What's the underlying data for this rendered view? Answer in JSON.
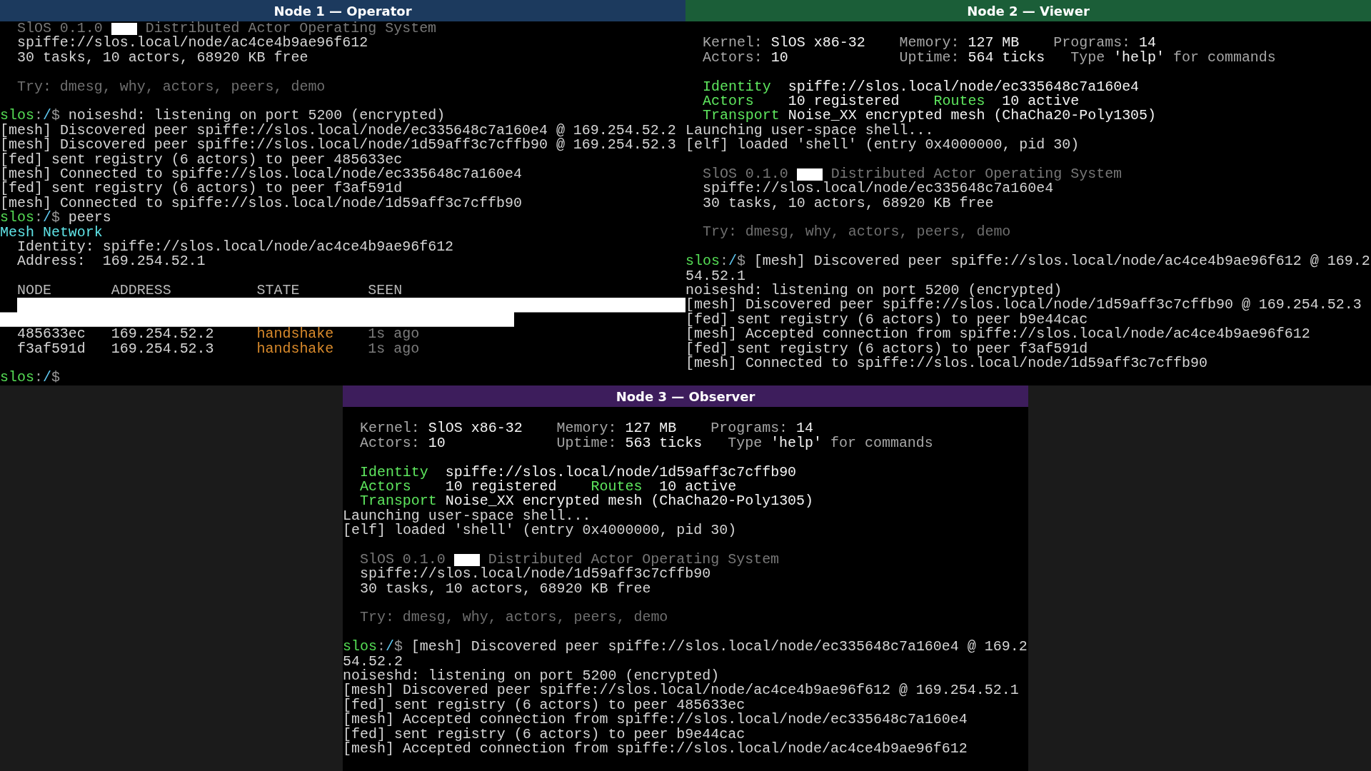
{
  "panels": [
    {
      "title": "Node 1 — Operator",
      "color": "#1c3a5e",
      "lines": [
        {
          "kind": "banner",
          "name": "SlOS 0.1.0",
          "tagline": "Distributed Actor Operating System"
        },
        {
          "kind": "info",
          "text": "spiffe://slos.local/node/ac4ce4b9ae96f612"
        },
        {
          "kind": "info",
          "text": "30 tasks, 10 actors, 68920 KB free"
        },
        {
          "kind": "blank"
        },
        {
          "kind": "hint",
          "text": "Try: dmesg, why, actors, peers, demo"
        },
        {
          "kind": "blank"
        },
        {
          "kind": "prompt",
          "host": "slos",
          "colon": ":",
          "path": "/",
          "sign": "$",
          "command": "noiseshd: listening on port 5200 (encrypted)"
        },
        {
          "kind": "output",
          "text": "[mesh] Discovered peer spiffe://slos.local/node/ec335648c7a160e4 @ 169.254.52.2"
        },
        {
          "kind": "output",
          "text": "[mesh] Discovered peer spiffe://slos.local/node/1d59aff3c7cffb90 @ 169.254.52.3"
        },
        {
          "kind": "output",
          "text": "[fed] sent registry (6 actors) to peer 485633ec"
        },
        {
          "kind": "output",
          "text": "[mesh] Connected to spiffe://slos.local/node/ec335648c7a160e4"
        },
        {
          "kind": "output",
          "text": "[fed] sent registry (6 actors) to peer f3af591d"
        },
        {
          "kind": "output",
          "text": "[mesh] Connected to spiffe://slos.local/node/1d59aff3c7cffb90"
        },
        {
          "kind": "prompt",
          "host": "slos",
          "colon": ":",
          "path": "/",
          "sign": "$",
          "command": "peers"
        },
        {
          "kind": "heading",
          "text": "Mesh Network"
        },
        {
          "kind": "field",
          "label": "Identity:",
          "value": "spiffe://slos.local/node/ac4ce4b9ae96f612"
        },
        {
          "kind": "field",
          "label": "Address:",
          "value": "169.254.52.1"
        },
        {
          "kind": "blank"
        },
        {
          "kind": "table",
          "columns": [
            "NODE",
            "ADDRESS",
            "STATE",
            "SEEN"
          ],
          "rows": [
            [
              "485633ec",
              "169.254.52.2",
              "handshake",
              "1s ago"
            ],
            [
              "f3af591d",
              "169.254.52.3",
              "handshake",
              "1s ago"
            ]
          ]
        },
        {
          "kind": "blank"
        },
        {
          "kind": "prompt",
          "host": "slos",
          "colon": ":",
          "path": "/",
          "sign": "$"
        }
      ]
    },
    {
      "title": "Node 2 — Viewer",
      "color": "#1b5e38",
      "lines": [
        {
          "kind": "blank"
        },
        {
          "kind": "sysinfo",
          "rows": [
            {
              "items": [
                {
                  "label": "Kernel:",
                  "value": "SlOS x86-32"
                },
                {
                  "label": "Memory:",
                  "value": "127 MB"
                },
                {
                  "label": "Programs:",
                  "value": "14"
                }
              ]
            },
            {
              "items": [
                {
                  "label": "Actors:",
                  "value": "10"
                },
                {
                  "label": "Uptime:",
                  "value": "564 ticks"
                }
              ],
              "tip": {
                "prefix": "Type",
                "command": "'help'",
                "suffix": "for commands"
              }
            }
          ]
        },
        {
          "kind": "blank"
        },
        {
          "kind": "status",
          "pairs": [
            {
              "label": "Identity",
              "value": "spiffe://slos.local/node/ec335648c7a160e4"
            }
          ]
        },
        {
          "kind": "status",
          "pairs": [
            {
              "label": "Actors",
              "value": "10 registered"
            },
            {
              "label": "Routes",
              "value": "10 active"
            }
          ]
        },
        {
          "kind": "status",
          "pairs": [
            {
              "label": "Transport",
              "value": "Noise_XX encrypted mesh (ChaCha20-Poly1305)"
            }
          ]
        },
        {
          "kind": "output",
          "text": "Launching user-space shell..."
        },
        {
          "kind": "output",
          "text": "[elf] loaded 'shell' (entry 0x4000000, pid 30)"
        },
        {
          "kind": "blank"
        },
        {
          "kind": "banner",
          "name": "SlOS 0.1.0",
          "tagline": "Distributed Actor Operating System"
        },
        {
          "kind": "info",
          "text": "spiffe://slos.local/node/ec335648c7a160e4"
        },
        {
          "kind": "info",
          "text": "30 tasks, 10 actors, 68920 KB free"
        },
        {
          "kind": "blank"
        },
        {
          "kind": "hint",
          "text": "Try: dmesg, why, actors, peers, demo"
        },
        {
          "kind": "blank"
        },
        {
          "kind": "prompt",
          "host": "slos",
          "colon": ":",
          "path": "/",
          "sign": "$",
          "command": "[mesh] Discovered peer spiffe://slos.local/node/ac4ce4b9ae96f612 @ 169.254.52.1"
        },
        {
          "kind": "output",
          "text": "noiseshd: listening on port 5200 (encrypted)"
        },
        {
          "kind": "output",
          "text": "[mesh] Discovered peer spiffe://slos.local/node/1d59aff3c7cffb90 @ 169.254.52.3"
        },
        {
          "kind": "output",
          "text": "[fed] sent registry (6 actors) to peer b9e44cac"
        },
        {
          "kind": "output",
          "text": "[mesh] Accepted connection from spiffe://slos.local/node/ac4ce4b9ae96f612"
        },
        {
          "kind": "output",
          "text": "[fed] sent registry (6 actors) to peer f3af591d"
        },
        {
          "kind": "output",
          "text": "[mesh] Connected to spiffe://slos.local/node/1d59aff3c7cffb90"
        }
      ]
    },
    {
      "title": "Node 3 — Observer",
      "color": "#3d1d5c",
      "lines": [
        {
          "kind": "blank"
        },
        {
          "kind": "sysinfo",
          "rows": [
            {
              "items": [
                {
                  "label": "Kernel:",
                  "value": "SlOS x86-32"
                },
                {
                  "label": "Memory:",
                  "value": "127 MB"
                },
                {
                  "label": "Programs:",
                  "value": "14"
                }
              ]
            },
            {
              "items": [
                {
                  "label": "Actors:",
                  "value": "10"
                },
                {
                  "label": "Uptime:",
                  "value": "563 ticks"
                }
              ],
              "tip": {
                "prefix": "Type",
                "command": "'help'",
                "suffix": "for commands"
              }
            }
          ]
        },
        {
          "kind": "blank"
        },
        {
          "kind": "status",
          "pairs": [
            {
              "label": "Identity",
              "value": "spiffe://slos.local/node/1d59aff3c7cffb90"
            }
          ]
        },
        {
          "kind": "status",
          "pairs": [
            {
              "label": "Actors",
              "value": "10 registered"
            },
            {
              "label": "Routes",
              "value": "10 active"
            }
          ]
        },
        {
          "kind": "status",
          "pairs": [
            {
              "label": "Transport",
              "value": "Noise_XX encrypted mesh (ChaCha20-Poly1305)"
            }
          ]
        },
        {
          "kind": "output",
          "text": "Launching user-space shell..."
        },
        {
          "kind": "output",
          "text": "[elf] loaded 'shell' (entry 0x4000000, pid 30)"
        },
        {
          "kind": "blank"
        },
        {
          "kind": "banner",
          "name": "SlOS 0.1.0",
          "tagline": "Distributed Actor Operating System"
        },
        {
          "kind": "info",
          "text": "spiffe://slos.local/node/1d59aff3c7cffb90"
        },
        {
          "kind": "info",
          "text": "30 tasks, 10 actors, 68920 KB free"
        },
        {
          "kind": "blank"
        },
        {
          "kind": "hint",
          "text": "Try: dmesg, why, actors, peers, demo"
        },
        {
          "kind": "blank"
        },
        {
          "kind": "prompt",
          "host": "slos",
          "colon": ":",
          "path": "/",
          "sign": "$",
          "command": "[mesh] Discovered peer spiffe://slos.local/node/ec335648c7a160e4 @ 169.254.52.2"
        },
        {
          "kind": "output",
          "text": "noiseshd: listening on port 5200 (encrypted)"
        },
        {
          "kind": "output",
          "text": "[mesh] Discovered peer spiffe://slos.local/node/ac4ce4b9ae96f612 @ 169.254.52.1"
        },
        {
          "kind": "output",
          "text": "[fed] sent registry (6 actors) to peer 485633ec"
        },
        {
          "kind": "output",
          "text": "[mesh] Accepted connection from spiffe://slos.local/node/ec335648c7a160e4"
        },
        {
          "kind": "output",
          "text": "[fed] sent registry (6 actors) to peer b9e44cac"
        },
        {
          "kind": "output",
          "text": "[mesh] Accepted connection from spiffe://slos.local/node/ac4ce4b9ae96f612"
        }
      ]
    }
  ]
}
